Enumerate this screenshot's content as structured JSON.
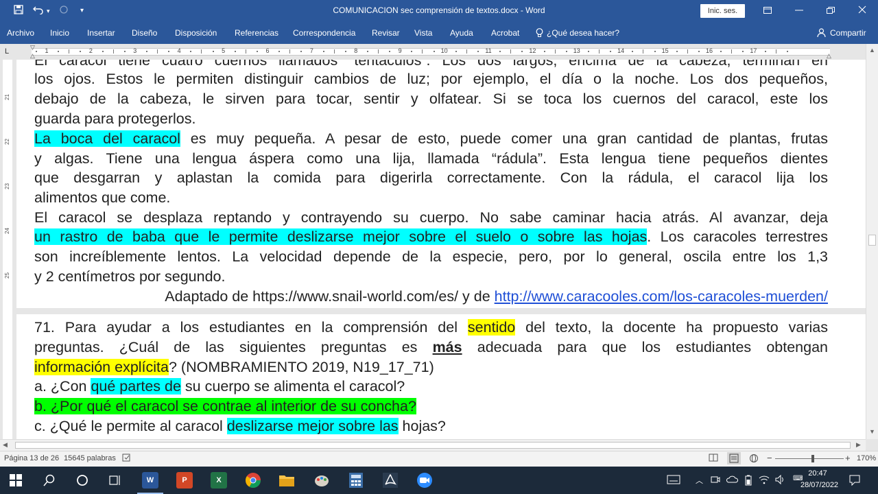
{
  "window": {
    "title": "COMUNICACION sec comprensión de textos.docx  -  Word",
    "signin_label": "Inic. ses."
  },
  "menu": [
    "Archivo",
    "Inicio",
    "Insertar",
    "Diseño",
    "Disposición",
    "Referencias",
    "Correspondencia",
    "Revisar",
    "Vista",
    "Ayuda",
    "Acrobat",
    "¿Qué desea hacer?"
  ],
  "share_label": "Compartir",
  "ruler": {
    "numbers": [
      "1",
      "2",
      "3",
      "4",
      "5",
      "6",
      "7",
      "8",
      "9",
      "10",
      "11",
      "12",
      "13",
      "14",
      "15",
      "16",
      "17"
    ],
    "vertical_numbers": [
      "21",
      "22",
      "23",
      "24",
      "25"
    ]
  },
  "document": {
    "l1": "El caracol tiene cuatro cuernos llamados “tentáculos”. Los dos largos, encima de la cabeza, terminan en",
    "l2": "los ojos. Estos le permiten distinguir cambios de luz; por ejemplo, el día o la noche. Los dos pequeños,",
    "l3": "debajo de la cabeza, le sirven para tocar, sentir y olfatear. Si se toca los cuernos del caracol, este los",
    "l4": "guarda para protegerlos.",
    "l5_hl": "La boca del caracol",
    "l5_rest": " es muy pequeña. A pesar de esto, puede comer una gran cantidad de plantas, frutas",
    "l6": "y algas. Tiene una lengua áspera como una lija, llamada “rádula”. Esta lengua tiene pequeños dientes",
    "l7": "que desgarran y aplastan la comida para digerirla correctamente. Con la rádula, el caracol lija los",
    "l8": "alimentos que come.",
    "l9": "El caracol se desplaza reptando y contrayendo su cuerpo. No sabe caminar hacia atrás. Al avanzar, deja",
    "l10_hl": "un rastro de baba que le permite deslizarse mejor sobre el suelo o sobre las hojas",
    "l10_rest": ". Los caracoles terrestres",
    "l11": "son increíblemente lentos. La velocidad depende de la especie, pero, por lo general, oscila entre los 1,3",
    "l12": "y 2 centímetros por segundo.",
    "l13_text": "Adaptado de https://www.snail-world.com/es/ y de ",
    "l13_link": "http://www.caracooles.com/los-caracoles-muerden/",
    "q1_a": "71. Para ayudar a los estudiantes en la comprensión del ",
    "q1_hl": "sentido",
    "q1_b": " del texto, la docente ha propuesto varias",
    "q2_a": "preguntas. ¿Cuál de las siguientes preguntas es ",
    "q2_bold": "más",
    "q2_b": " adecuada para que los estudiantes obtengan",
    "q3_hl": "información explícita",
    "q3_rest": "? (NOMBRAMIENTO 2019, N19_17_71)",
    "oa_a": "a. ¿Con ",
    "oa_hl": "qué partes de",
    "oa_b": " su cuerpo se alimenta el caracol?",
    "ob": "b. ¿Por qué el caracol se contrae al interior de su concha?",
    "oc_a": "c. ¿Qué le permite al caracol ",
    "oc_hl": "deslizarse mejor sobre las",
    "oc_b": " hojas?"
  },
  "status": {
    "page": "Página 13 de 26",
    "words": "15645 palabras",
    "zoom": "170%"
  },
  "taskbar": {
    "time": "20:47",
    "date": "28/07/2022"
  },
  "colors": {
    "word_blue": "#2b579a",
    "highlight_cyan": "#00ffff",
    "highlight_yellow": "#ffff00",
    "highlight_green": "#00ff00"
  }
}
